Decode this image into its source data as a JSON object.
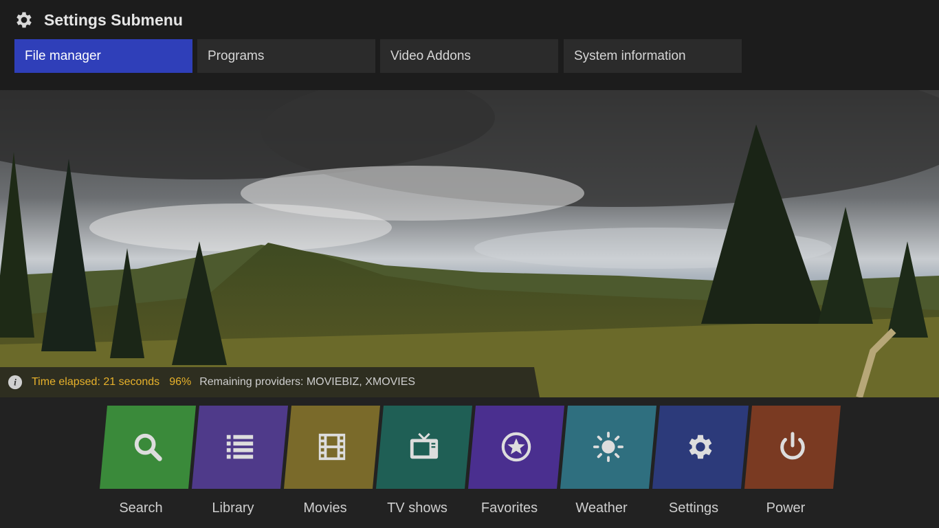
{
  "header": {
    "title": "Settings Submenu",
    "tabs": [
      {
        "label": "File manager",
        "active": true
      },
      {
        "label": "Programs",
        "active": false
      },
      {
        "label": "Video Addons",
        "active": false
      },
      {
        "label": "System information",
        "active": false
      }
    ]
  },
  "info_bar": {
    "elapsed": "Time elapsed: 21 seconds",
    "percent": "96%",
    "remaining": "Remaining providers: MOVIEBIZ, XMOVIES"
  },
  "nav": [
    {
      "label": "Search",
      "icon": "search-icon",
      "color": "#3a8a3a"
    },
    {
      "label": "Library",
      "icon": "list-icon",
      "color": "#4f3a8a"
    },
    {
      "label": "Movies",
      "icon": "film-icon",
      "color": "#7a6a2a"
    },
    {
      "label": "TV shows",
      "icon": "tv-icon",
      "color": "#1f5f55"
    },
    {
      "label": "Favorites",
      "icon": "star-icon",
      "color": "#4a2f8f"
    },
    {
      "label": "Weather",
      "icon": "sun-icon",
      "color": "#2f6f7f"
    },
    {
      "label": "Settings",
      "icon": "gear-icon",
      "color": "#2c3a7a"
    },
    {
      "label": "Power",
      "icon": "power-icon",
      "color": "#7a3a22"
    }
  ],
  "colors": {
    "accent": "#2f3fb9",
    "status_text": "#e8b22b"
  }
}
